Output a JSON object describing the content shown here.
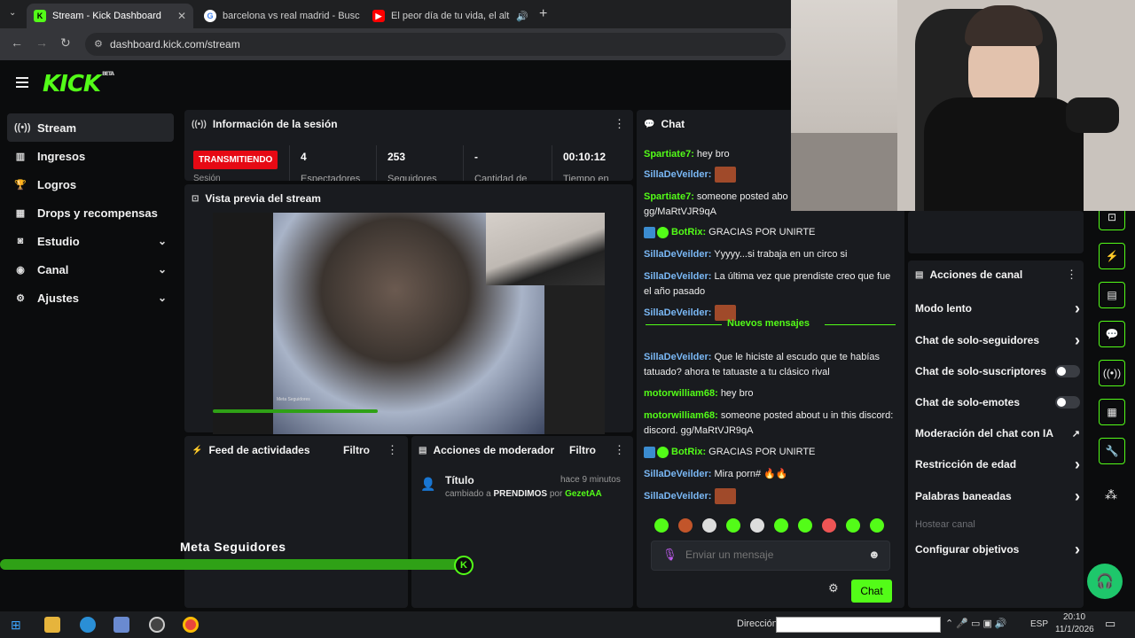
{
  "browser": {
    "tabs": [
      {
        "title": "Stream - Kick Dashboard",
        "active": true
      },
      {
        "title": "barcelona vs real madrid - Busc",
        "active": false
      },
      {
        "title": "El peor día de tu vida, el alt",
        "active": false
      }
    ],
    "url": "dashboard.kick.com/stream"
  },
  "sidebar": {
    "items": [
      {
        "label": "Stream",
        "icon": "broadcast-icon",
        "active": true
      },
      {
        "label": "Ingresos",
        "icon": "chart-icon"
      },
      {
        "label": "Logros",
        "icon": "trophy-icon"
      },
      {
        "label": "Drops y recompensas",
        "icon": "gift-icon"
      },
      {
        "label": "Estudio",
        "icon": "studio-icon",
        "expandable": true
      },
      {
        "label": "Canal",
        "icon": "channel-icon",
        "expandable": true
      },
      {
        "label": "Ajustes",
        "icon": "gear-icon",
        "expandable": true
      }
    ]
  },
  "session": {
    "title": "Información de la sesión",
    "status": "TRANSMITIENDO",
    "status_sub": "Sesión",
    "stats": [
      {
        "value": "4",
        "label": "Espectadores"
      },
      {
        "value": "253",
        "label": "Seguidores"
      },
      {
        "value": "-",
        "label": "Cantidad de"
      },
      {
        "value": "00:10:12",
        "label": "Tiempo en"
      }
    ]
  },
  "preview": {
    "title": "Vista previa del stream",
    "overlay_caption": "Meta Seguidores"
  },
  "feed": {
    "title": "Feed de actividades",
    "filter": "Filtro"
  },
  "modactions": {
    "title": "Acciones de moderador",
    "filter": "Filtro",
    "item": {
      "title": "Título",
      "time": "hace 9 minutos",
      "pre": "cambiado a",
      "value": "PRENDIMOS",
      "by": "por",
      "user": "GezetAA"
    }
  },
  "overlay": {
    "goal_label": "Meta Seguidores"
  },
  "chat": {
    "title": "Chat",
    "messages": [
      {
        "user": "Spartiate7:",
        "text": "hey bro",
        "color": "#53fc18"
      },
      {
        "user": "SillaDeVeilder:",
        "text": "",
        "color": "#7ab8f5",
        "emote": true
      },
      {
        "user": "Spartiate7:",
        "text": "someone posted abo discord. gg/MaRtVJR9qA",
        "color": "#53fc18"
      },
      {
        "user": "BotRix:",
        "text": "GRACIAS POR UNIRTE",
        "color": "#53fc18",
        "bot": true
      },
      {
        "user": "SillaDeVeilder:",
        "text": "Yyyyy...si trabaja en un circo si",
        "color": "#7ab8f5"
      },
      {
        "user": "SillaDeVeilder:",
        "text": "La última vez que prendiste creo que fue el año pasado",
        "color": "#7ab8f5"
      },
      {
        "user": "SillaDeVeilder:",
        "text": "",
        "color": "#7ab8f5",
        "emote": true
      }
    ],
    "new_label": "Nuevos mensajes",
    "messages_new": [
      {
        "user": "SillaDeVeilder:",
        "text": "Que le hiciste al escudo que te habías tatuado? ahora te tatuaste a tu clásico rival",
        "color": "#7ab8f5"
      },
      {
        "user": "motorwilliam68:",
        "text": "hey bro",
        "color": "#53fc18"
      },
      {
        "user": "motorwilliam68:",
        "text": "someone posted about u in this discord: discord. gg/MaRtVJR9qA",
        "color": "#53fc18"
      },
      {
        "user": "BotRix:",
        "text": "GRACIAS POR UNIRTE",
        "color": "#53fc18",
        "bot": true
      },
      {
        "user": "SillaDeVeilder:",
        "text": "Mira porn# 🔥🔥",
        "color": "#7ab8f5"
      },
      {
        "user": "SillaDeVeilder:",
        "text": "",
        "color": "#7ab8f5",
        "emote": true
      }
    ],
    "placeholder": "Enviar un mensaje",
    "send_label": "Chat"
  },
  "channel_actions": {
    "title": "Acciones de canal",
    "items": [
      {
        "label": "Modo lento",
        "control": "chevron"
      },
      {
        "label": "Chat de solo-seguidores",
        "control": "chevron"
      },
      {
        "label": "Chat de solo-suscriptores",
        "control": "toggle"
      },
      {
        "label": "Chat de solo-emotes",
        "control": "toggle"
      },
      {
        "label": "Moderación del chat con IA",
        "control": "external"
      },
      {
        "label": "Restricción de edad",
        "control": "chevron"
      },
      {
        "label": "Palabras baneadas",
        "control": "chevron"
      },
      {
        "label": "Hostear canal",
        "control": "none",
        "disabled": true
      },
      {
        "label": "Configurar objetivos",
        "control": "chevron"
      }
    ]
  },
  "taskbar": {
    "direccion_label": "Dirección",
    "lang": "ESP",
    "time": "20:10",
    "date": "11/1/2026"
  },
  "colors": {
    "accent": "#53fc18",
    "live": "#e60914",
    "panel": "#191b1f"
  }
}
